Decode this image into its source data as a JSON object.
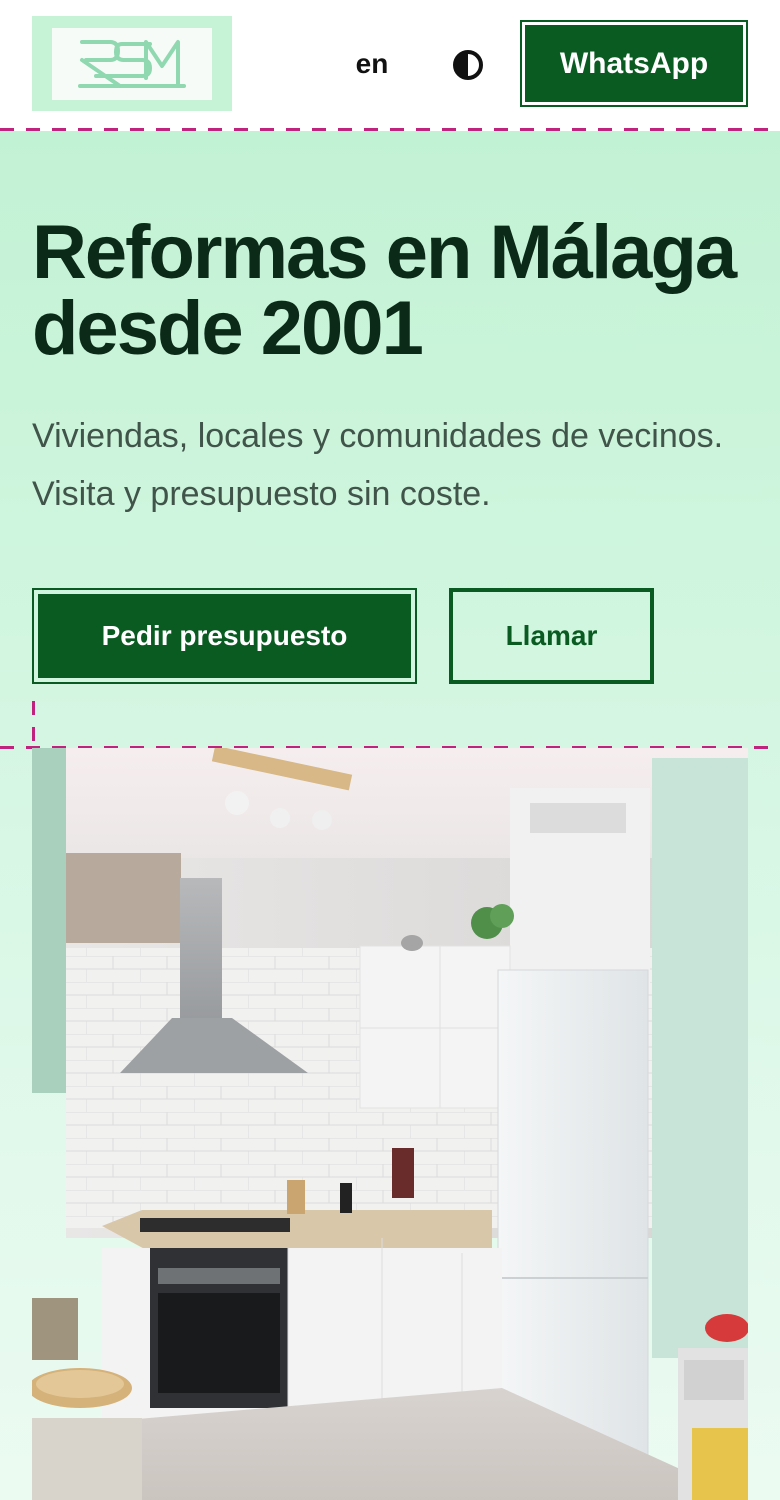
{
  "header": {
    "logo_text": "RSM",
    "lang_label": "en",
    "contrast_icon": "contrast-icon",
    "whatsapp_label": "WhatsApp"
  },
  "hero": {
    "title": "Reformas en Málaga desde 2001",
    "subtitle": "Viviendas, locales y comunidades de vecinos. Visita y presupuesto sin coste.",
    "primary_cta": "Pedir presupuesto",
    "secondary_cta": "Llamar"
  },
  "colors": {
    "brand_green": "#0a5b22",
    "hero_bg": "#c2f2d4",
    "logo_bg": "#c6f2d6",
    "accent_dash": "#c0237d",
    "headline": "#0b2a18"
  }
}
